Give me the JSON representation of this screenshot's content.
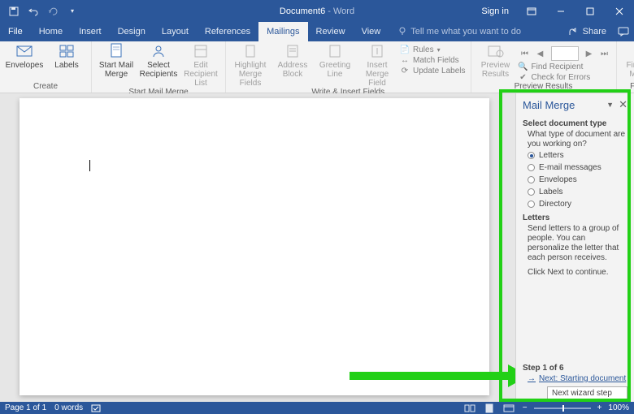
{
  "title": {
    "doc": "Document6",
    "app": "Word"
  },
  "signin": "Sign in",
  "tabs": [
    "File",
    "Home",
    "Insert",
    "Design",
    "Layout",
    "References",
    "Mailings",
    "Review",
    "View"
  ],
  "active_tab_index": 6,
  "tellme": "Tell me what you want to do",
  "share": "Share",
  "ribbon": {
    "create": {
      "label": "Create",
      "envelopes": "Envelopes",
      "labels": "Labels"
    },
    "start": {
      "label": "Start Mail Merge",
      "start_btn": "Start Mail\nMerge",
      "select_btn": "Select\nRecipients",
      "edit_btn": "Edit\nRecipient List"
    },
    "write": {
      "label": "Write & Insert Fields",
      "highlight": "Highlight\nMerge Fields",
      "address": "Address\nBlock",
      "greeting": "Greeting\nLine",
      "insert": "Insert Merge\nField",
      "rules": "Rules",
      "match": "Match Fields",
      "update": "Update Labels"
    },
    "preview": {
      "label": "Preview Results",
      "preview_btn": "Preview\nResults",
      "find": "Find Recipient",
      "check": "Check for Errors"
    },
    "finish": {
      "label": "Finish",
      "finish_btn": "Finish &\nMerge"
    }
  },
  "pane": {
    "title": "Mail Merge",
    "section1_title": "Select document type",
    "question": "What type of document are you working on?",
    "options": [
      "Letters",
      "E-mail messages",
      "Envelopes",
      "Labels",
      "Directory"
    ],
    "selected_option": 0,
    "section2_title": "Letters",
    "desc": "Send letters to a group of people. You can personalize the letter that each person receives.",
    "next_prompt": "Click Next to continue.",
    "step_label": "Step 1 of 6",
    "next_link": "Next: Starting document",
    "tooltip": "Next wizard step"
  },
  "status": {
    "page": "Page 1 of 1",
    "words": "0 words",
    "zoom": "100%"
  }
}
